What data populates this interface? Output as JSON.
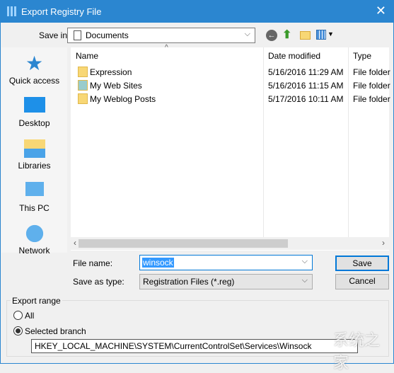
{
  "title": "Export Registry File",
  "save_in": {
    "label": "Save in:",
    "value": "Documents"
  },
  "sidebar": [
    {
      "label": "Quick access",
      "icon": "star-icon"
    },
    {
      "label": "Desktop",
      "icon": "desktop-icon"
    },
    {
      "label": "Libraries",
      "icon": "libraries-icon"
    },
    {
      "label": "This PC",
      "icon": "computer-icon"
    },
    {
      "label": "Network",
      "icon": "network-icon"
    }
  ],
  "columns": [
    "Name",
    "Date modified",
    "Type"
  ],
  "files": [
    {
      "name": "Expression",
      "date": "5/16/2016 11:29 AM",
      "type": "File folder"
    },
    {
      "name": "My Web Sites",
      "date": "5/16/2016 11:15 AM",
      "type": "File folder"
    },
    {
      "name": "My Weblog Posts",
      "date": "5/17/2016 10:11 AM",
      "type": "File folder"
    }
  ],
  "file_name": {
    "label": "File name:",
    "value": "winsock"
  },
  "save_type": {
    "label": "Save as type:",
    "value": "Registration Files (*.reg)"
  },
  "buttons": {
    "save": "Save",
    "cancel": "Cancel"
  },
  "export_range": {
    "label": "Export range",
    "all": "All",
    "selected": "Selected branch",
    "selected_option": "Selected branch",
    "path": "HKEY_LOCAL_MACHINE\\SYSTEM\\CurrentControlSet\\Services\\Winsock"
  },
  "watermark": "系统之家",
  "colors": {
    "titlebar": "#2b86d0",
    "selection": "#3399ff"
  }
}
